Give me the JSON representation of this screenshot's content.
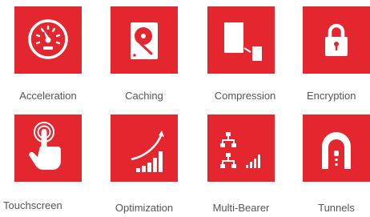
{
  "colors": {
    "tile_red": "#e4262e",
    "label_gray": "#555555",
    "background": "#ffffff"
  },
  "features": [
    {
      "label": "Acceleration",
      "icon": "speedometer-icon"
    },
    {
      "label": "Caching",
      "icon": "hard-drive-icon"
    },
    {
      "label": "Compression",
      "icon": "compression-icon"
    },
    {
      "label": "Encryption",
      "icon": "padlock-icon"
    },
    {
      "label": "Touchscreen",
      "icon": "touch-hand-icon"
    },
    {
      "label": "Optimization",
      "icon": "growth-chart-icon"
    },
    {
      "label": "Multi-Bearer",
      "icon": "network-icon"
    },
    {
      "label": "Tunnels",
      "icon": "tunnel-icon"
    }
  ]
}
